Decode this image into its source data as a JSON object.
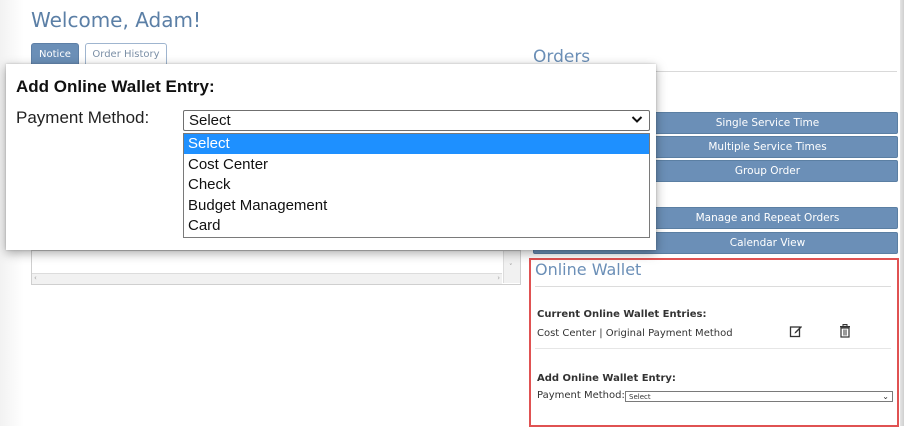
{
  "header": {
    "welcome": "Welcome, Adam!"
  },
  "tabs": [
    {
      "label": "Notice",
      "active": true
    },
    {
      "label": "Order History",
      "active": false
    }
  ],
  "orders": {
    "title": "Orders",
    "buttons": [
      "Single Service Time",
      "Multiple Service Times",
      "Group Order",
      "Manage and Repeat Orders",
      "Calendar View"
    ]
  },
  "wallet": {
    "title": "Online Wallet",
    "current_heading": "Current Online Wallet Entries:",
    "entry_text": "Cost Center | Original Payment Method",
    "add_heading": "Add Online Wallet Entry:",
    "payment_label": "Payment Method:",
    "select_value": "Select",
    "edit_icon": "edit-icon",
    "delete_icon": "trash-icon",
    "border_color": "#e05252"
  },
  "popup": {
    "title": "Add Online Wallet Entry:",
    "label": "Payment Method:",
    "select_value": "Select",
    "options": [
      "Select",
      "Cost Center",
      "Check",
      "Budget Management",
      "Card"
    ],
    "highlight_color": "#1e90ff"
  },
  "colors": {
    "accent": "#6b8fb7"
  }
}
